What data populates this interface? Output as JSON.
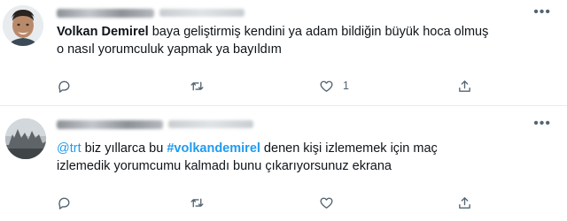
{
  "tweets": [
    {
      "author_name": "",
      "author_handle": "",
      "text": {
        "bold_name": "Volkan Demirel",
        "rest_line1": " baya geliştirmiş kendini ya adam bildiğin büyük hoca olmuş",
        "line2": "o nasıl yorumculuk yapmak ya bayıldım"
      },
      "actions": {
        "replies": "",
        "retweets": "",
        "likes": "1"
      }
    },
    {
      "author_name": "",
      "author_handle": "",
      "text": {
        "mention": "@trt",
        "part1": " biz yıllarca bu ",
        "hashtag": "#volkandemirel",
        "part2": " denen kişi izlememek için maç",
        "line2": "izlemedik yorumcumu kalmadı bunu çıkarıyorsunuz ekrana"
      },
      "actions": {
        "replies": "",
        "retweets": "",
        "likes": ""
      }
    }
  ],
  "icons": {
    "more": "more-icon",
    "reply": "reply-icon",
    "retweet": "retweet-icon",
    "like": "heart-icon",
    "share": "share-icon"
  },
  "colors": {
    "text": "#0f1419",
    "muted": "#536471",
    "link": "#1d9bf0",
    "divider": "#e6ecf0"
  }
}
